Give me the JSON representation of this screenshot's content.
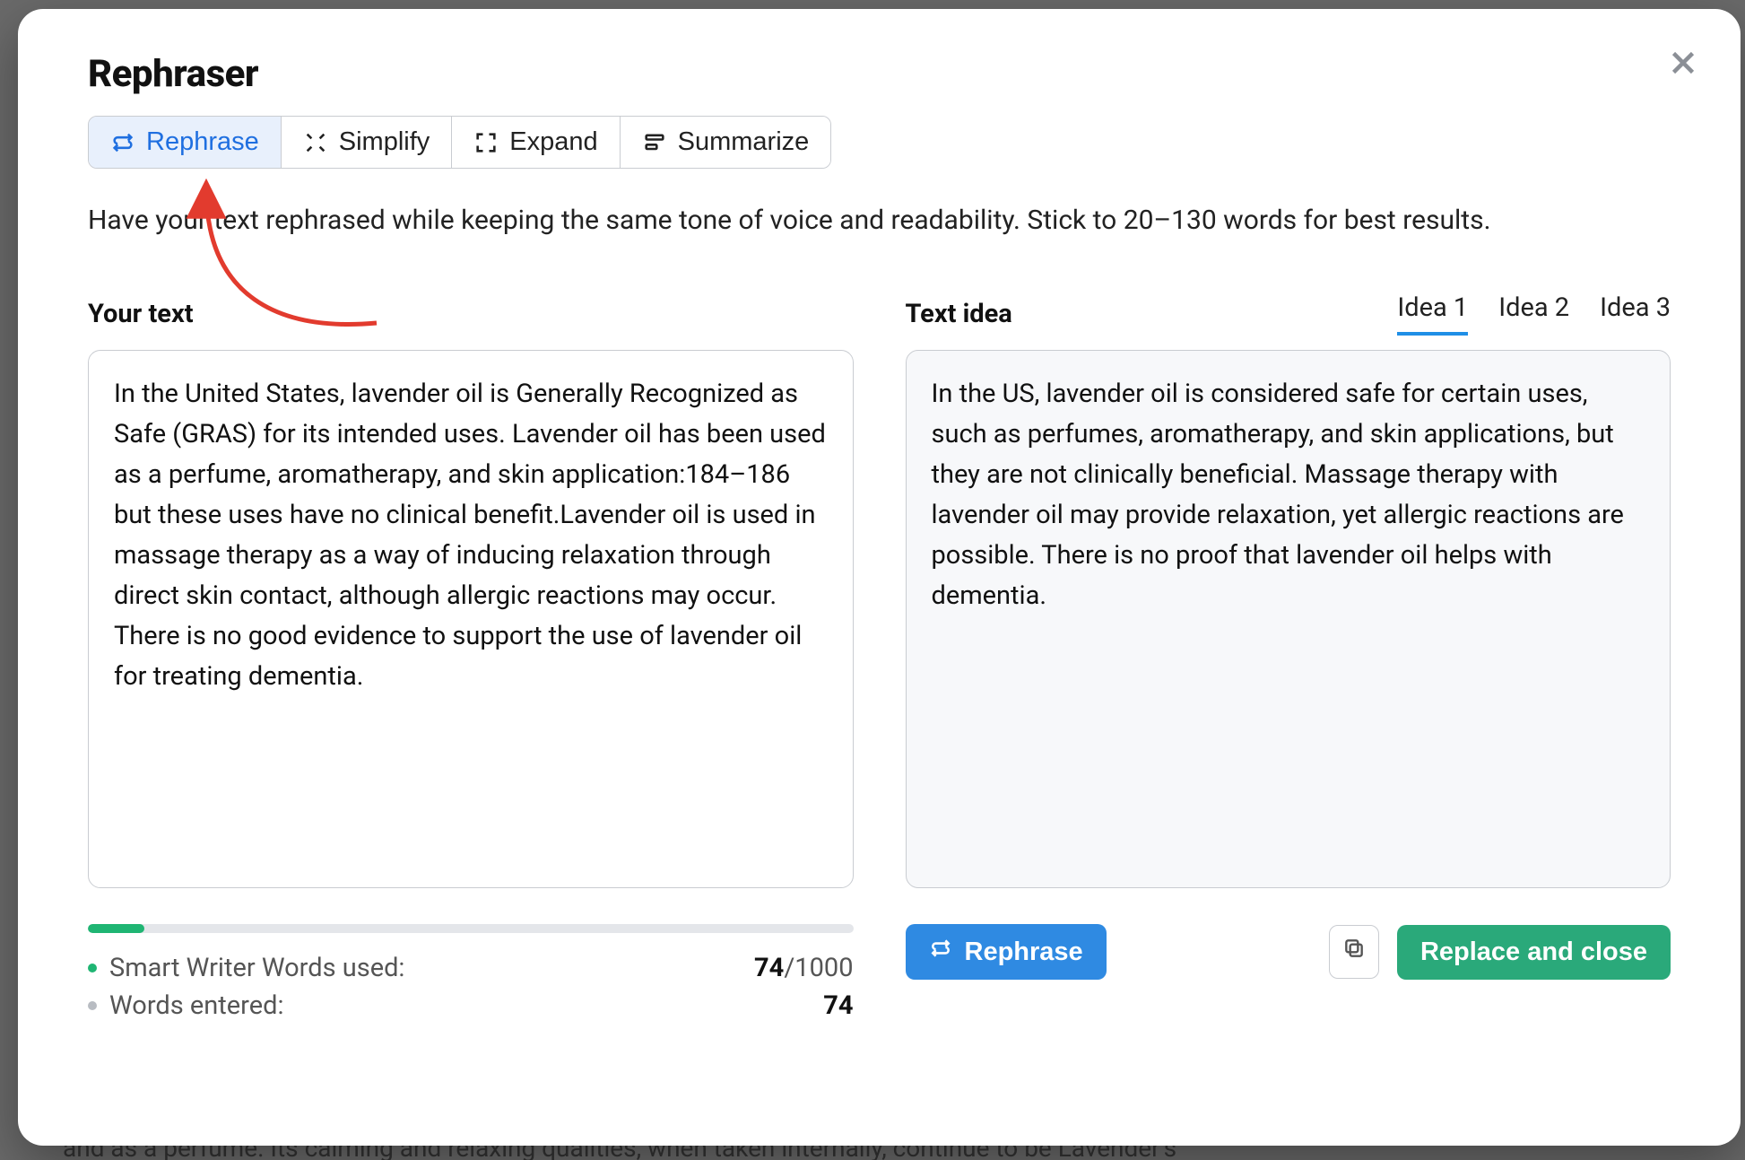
{
  "modal": {
    "title": "Rephraser",
    "description": "Have your text rephrased while keeping the same tone of voice and readability. Stick to 20–130 words for best results."
  },
  "tabs": {
    "rephrase": "Rephrase",
    "simplify": "Simplify",
    "expand": "Expand",
    "summarize": "Summarize",
    "active": "rephrase"
  },
  "left": {
    "title": "Your text",
    "text": "In the United States, lavender oil is Generally Recognized as Safe (GRAS) for its intended uses. Lavender oil has been used as a perfume, aromatherapy, and skin application:184–186 but these uses have no clinical benefit.Lavender oil is used in massage therapy as a way of inducing relaxation through direct skin contact, although allergic reactions may occur. There is no good evidence to support the use of lavender oil for treating dementia."
  },
  "right": {
    "title": "Text idea",
    "ideas": [
      {
        "label": "Idea 1"
      },
      {
        "label": "Idea 2"
      },
      {
        "label": "Idea 3"
      }
    ],
    "active_index": 0,
    "idea_text": "In the US, lavender oil is considered safe for certain uses, such as perfumes, aromatherapy, and skin applications, but they are not clinically beneficial. Massage therapy with lavender oil may provide relaxation, yet allergic reactions are possible. There is no proof that lavender oil helps with dementia."
  },
  "stats": {
    "smart_writer_label": "Smart Writer Words used:",
    "smart_writer_used": "74",
    "smart_writer_limit": "/1000",
    "words_entered_label": "Words entered:",
    "words_entered": "74",
    "progress_percent": 7.4
  },
  "actions": {
    "rephrase": "Rephrase",
    "replace_close": "Replace and close"
  },
  "background_strip": "and as a perfume. Its calming and relaxing qualities, when taken internally, continue to be Lavender's"
}
